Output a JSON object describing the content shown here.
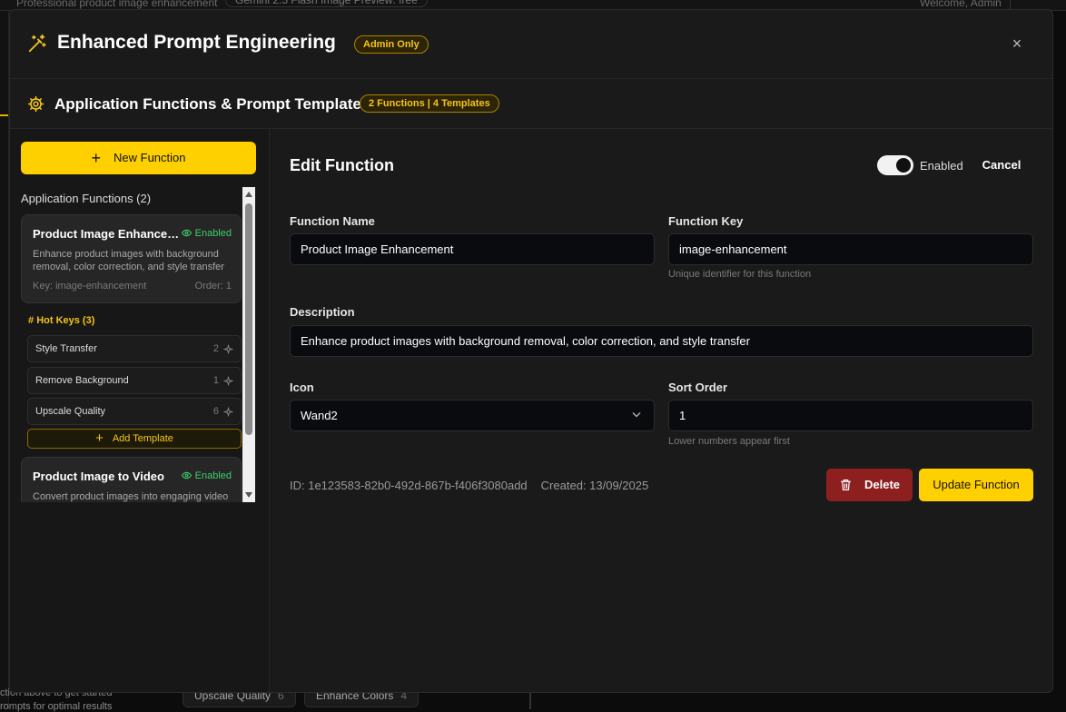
{
  "background": {
    "top_subtitle": "Professional product image enhancement",
    "model_pill": "Gemini 2.5 Flash Image Preview: free",
    "welcome": "Welcome, Admin",
    "bottom_hint_1": "ction above to get started",
    "bottom_hint_2": "rompts for optimal results",
    "chips": [
      {
        "label": "Upscale Quality",
        "count": "6"
      },
      {
        "label": "Enhance Colors",
        "count": "4"
      }
    ]
  },
  "modal": {
    "title": "Enhanced Prompt Engineering",
    "badge": "Admin Only",
    "close_icon": "×",
    "section_title": "Application Functions & Prompt Templates",
    "section_badge": "2 Functions | 4 Templates"
  },
  "sidebar": {
    "new_button": "New Function",
    "list_title": "Application Functions (2)",
    "functions": [
      {
        "name": "Product Image Enhancement",
        "status": "Enabled",
        "description": "Enhance product images with background removal, color correction, and style transfer",
        "key_line": "Key: image-enhancement",
        "order_line": "Order: 1",
        "hotkeys_title": "Hot Keys (3)",
        "hotkeys": [
          {
            "label": "Style Transfer",
            "count": "2"
          },
          {
            "label": "Remove Background",
            "count": "1"
          },
          {
            "label": "Upscale Quality",
            "count": "6"
          }
        ],
        "add_template": "Add Template"
      },
      {
        "name": "Product Image to Video",
        "status": "Enabled",
        "description": "Convert product images into engaging video content with animations and effects"
      }
    ]
  },
  "editor": {
    "title": "Edit Function",
    "toggle_label": "Enabled",
    "toggle_on": true,
    "cancel": "Cancel",
    "function_name": {
      "label": "Function Name",
      "value": "Product Image Enhancement"
    },
    "function_key": {
      "label": "Function Key",
      "value": "image-enhancement",
      "hint": "Unique identifier for this function"
    },
    "description": {
      "label": "Description",
      "value": "Enhance product images with background removal, color correction, and style transfer"
    },
    "icon": {
      "label": "Icon",
      "value": "Wand2"
    },
    "sort_order": {
      "label": "Sort Order",
      "value": "1",
      "hint": "Lower numbers appear first"
    },
    "id_text": "ID: 1e123583-82b0-492d-867b-f406f3080add",
    "created_text": "Created: 13/09/2025",
    "delete": "Delete",
    "update": "Update Function"
  },
  "colors": {
    "accent": "#ffd000",
    "danger": "#8e1f1f",
    "success": "#3fcf6a"
  },
  "icons": [
    "wand-icon",
    "gear-icon",
    "close-icon",
    "plus-icon",
    "eye-icon",
    "sparkle-icon",
    "chevron-down-icon",
    "trash-icon"
  ]
}
